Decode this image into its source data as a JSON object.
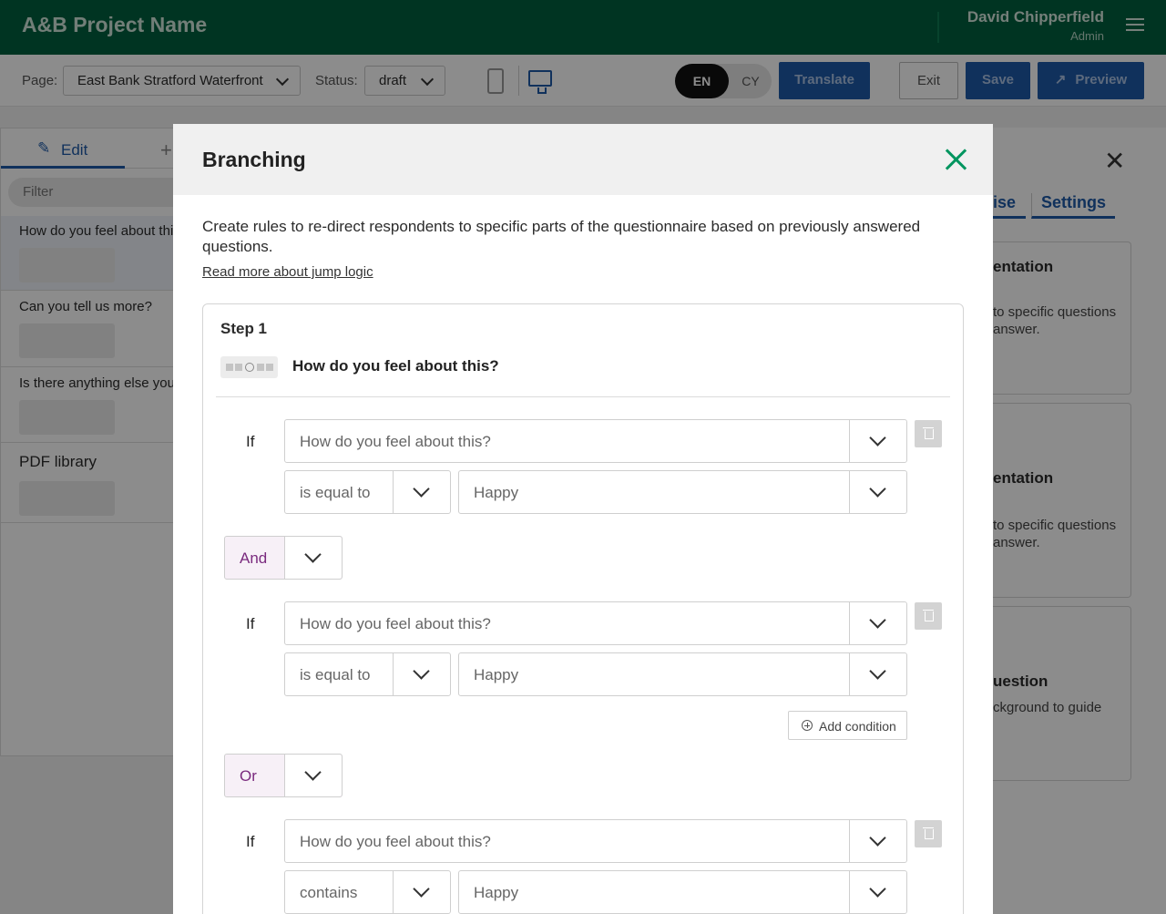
{
  "header": {
    "project_name": "A&B Project Name",
    "user_name": "David Chipperfield",
    "user_role": "Admin"
  },
  "toolbar": {
    "page_label": "Page:",
    "page_value": "East Bank Stratford Waterfront",
    "status_label": "Status:",
    "status_value": "draft",
    "lang_active": "EN",
    "lang_inactive": "CY",
    "translate_label": "Translate",
    "exit_label": "Exit",
    "save_label": "Save",
    "preview_label": "Preview"
  },
  "left_panel": {
    "edit_tab": "Edit",
    "filter_placeholder": "Filter",
    "items": [
      {
        "title": "How do you feel about thi"
      },
      {
        "title": "Can you tell us more?"
      },
      {
        "title": "Is there anything else you"
      },
      {
        "title": "PDF library"
      }
    ]
  },
  "right_panel": {
    "tab_partial": "ise",
    "tab_settings": "Settings",
    "cards": [
      {
        "heading": "entation",
        "text": "to specific questions answer."
      },
      {
        "heading": "entation",
        "text": "to specific questions answer."
      },
      {
        "heading": "uestion",
        "text": "ckground to guide"
      }
    ]
  },
  "modal": {
    "title": "Branching",
    "intro": "Create rules to re-direct respondents to specific parts of the questionnaire based on previously answered questions.",
    "read_more": "Read more about jump logic",
    "step": {
      "label": "Step 1",
      "question": "How do you feel about this?",
      "rules": [
        {
          "if_label": "If",
          "question": "How do you feel about this?",
          "operator": "is equal to",
          "value": "Happy"
        },
        {
          "connector": "And"
        },
        {
          "if_label": "If",
          "question": "How do you feel about this?",
          "operator": "is equal to",
          "value": "Happy"
        },
        {
          "add_condition": "Add condition"
        },
        {
          "connector": "Or"
        },
        {
          "if_label": "If",
          "question": "How do you feel about this?",
          "operator": "contains",
          "value": "Happy"
        }
      ]
    }
  }
}
